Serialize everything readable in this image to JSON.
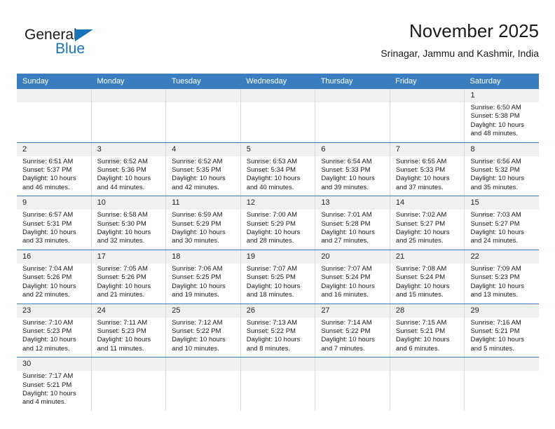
{
  "brand": {
    "name_part1": "General",
    "name_part2": "Blue",
    "triangle_color": "#1574bb"
  },
  "header": {
    "title": "November 2025",
    "subtitle": "Srinagar, Jammu and Kashmir, India"
  },
  "theme": {
    "header_blue": "#3a7ebf",
    "date_band_gray": "#f0f0f0",
    "grid_line": "#d9d9d9",
    "text": "#1a1a1a"
  },
  "weekdays": [
    "Sunday",
    "Monday",
    "Tuesday",
    "Wednesday",
    "Thursday",
    "Friday",
    "Saturday"
  ],
  "weeks": [
    [
      {
        "day": "",
        "lines": []
      },
      {
        "day": "",
        "lines": []
      },
      {
        "day": "",
        "lines": []
      },
      {
        "day": "",
        "lines": []
      },
      {
        "day": "",
        "lines": []
      },
      {
        "day": "",
        "lines": []
      },
      {
        "day": "1",
        "lines": [
          "Sunrise: 6:50 AM",
          "Sunset: 5:38 PM",
          "Daylight: 10 hours",
          "and 48 minutes."
        ]
      }
    ],
    [
      {
        "day": "2",
        "lines": [
          "Sunrise: 6:51 AM",
          "Sunset: 5:37 PM",
          "Daylight: 10 hours",
          "and 46 minutes."
        ]
      },
      {
        "day": "3",
        "lines": [
          "Sunrise: 6:52 AM",
          "Sunset: 5:36 PM",
          "Daylight: 10 hours",
          "and 44 minutes."
        ]
      },
      {
        "day": "4",
        "lines": [
          "Sunrise: 6:52 AM",
          "Sunset: 5:35 PM",
          "Daylight: 10 hours",
          "and 42 minutes."
        ]
      },
      {
        "day": "5",
        "lines": [
          "Sunrise: 6:53 AM",
          "Sunset: 5:34 PM",
          "Daylight: 10 hours",
          "and 40 minutes."
        ]
      },
      {
        "day": "6",
        "lines": [
          "Sunrise: 6:54 AM",
          "Sunset: 5:33 PM",
          "Daylight: 10 hours",
          "and 39 minutes."
        ]
      },
      {
        "day": "7",
        "lines": [
          "Sunrise: 6:55 AM",
          "Sunset: 5:33 PM",
          "Daylight: 10 hours",
          "and 37 minutes."
        ]
      },
      {
        "day": "8",
        "lines": [
          "Sunrise: 6:56 AM",
          "Sunset: 5:32 PM",
          "Daylight: 10 hours",
          "and 35 minutes."
        ]
      }
    ],
    [
      {
        "day": "9",
        "lines": [
          "Sunrise: 6:57 AM",
          "Sunset: 5:31 PM",
          "Daylight: 10 hours",
          "and 33 minutes."
        ]
      },
      {
        "day": "10",
        "lines": [
          "Sunrise: 6:58 AM",
          "Sunset: 5:30 PM",
          "Daylight: 10 hours",
          "and 32 minutes."
        ]
      },
      {
        "day": "11",
        "lines": [
          "Sunrise: 6:59 AM",
          "Sunset: 5:29 PM",
          "Daylight: 10 hours",
          "and 30 minutes."
        ]
      },
      {
        "day": "12",
        "lines": [
          "Sunrise: 7:00 AM",
          "Sunset: 5:29 PM",
          "Daylight: 10 hours",
          "and 28 minutes."
        ]
      },
      {
        "day": "13",
        "lines": [
          "Sunrise: 7:01 AM",
          "Sunset: 5:28 PM",
          "Daylight: 10 hours",
          "and 27 minutes."
        ]
      },
      {
        "day": "14",
        "lines": [
          "Sunrise: 7:02 AM",
          "Sunset: 5:27 PM",
          "Daylight: 10 hours",
          "and 25 minutes."
        ]
      },
      {
        "day": "15",
        "lines": [
          "Sunrise: 7:03 AM",
          "Sunset: 5:27 PM",
          "Daylight: 10 hours",
          "and 24 minutes."
        ]
      }
    ],
    [
      {
        "day": "16",
        "lines": [
          "Sunrise: 7:04 AM",
          "Sunset: 5:26 PM",
          "Daylight: 10 hours",
          "and 22 minutes."
        ]
      },
      {
        "day": "17",
        "lines": [
          "Sunrise: 7:05 AM",
          "Sunset: 5:26 PM",
          "Daylight: 10 hours",
          "and 21 minutes."
        ]
      },
      {
        "day": "18",
        "lines": [
          "Sunrise: 7:06 AM",
          "Sunset: 5:25 PM",
          "Daylight: 10 hours",
          "and 19 minutes."
        ]
      },
      {
        "day": "19",
        "lines": [
          "Sunrise: 7:07 AM",
          "Sunset: 5:25 PM",
          "Daylight: 10 hours",
          "and 18 minutes."
        ]
      },
      {
        "day": "20",
        "lines": [
          "Sunrise: 7:07 AM",
          "Sunset: 5:24 PM",
          "Daylight: 10 hours",
          "and 16 minutes."
        ]
      },
      {
        "day": "21",
        "lines": [
          "Sunrise: 7:08 AM",
          "Sunset: 5:24 PM",
          "Daylight: 10 hours",
          "and 15 minutes."
        ]
      },
      {
        "day": "22",
        "lines": [
          "Sunrise: 7:09 AM",
          "Sunset: 5:23 PM",
          "Daylight: 10 hours",
          "and 13 minutes."
        ]
      }
    ],
    [
      {
        "day": "23",
        "lines": [
          "Sunrise: 7:10 AM",
          "Sunset: 5:23 PM",
          "Daylight: 10 hours",
          "and 12 minutes."
        ]
      },
      {
        "day": "24",
        "lines": [
          "Sunrise: 7:11 AM",
          "Sunset: 5:23 PM",
          "Daylight: 10 hours",
          "and 11 minutes."
        ]
      },
      {
        "day": "25",
        "lines": [
          "Sunrise: 7:12 AM",
          "Sunset: 5:22 PM",
          "Daylight: 10 hours",
          "and 10 minutes."
        ]
      },
      {
        "day": "26",
        "lines": [
          "Sunrise: 7:13 AM",
          "Sunset: 5:22 PM",
          "Daylight: 10 hours",
          "and 8 minutes."
        ]
      },
      {
        "day": "27",
        "lines": [
          "Sunrise: 7:14 AM",
          "Sunset: 5:22 PM",
          "Daylight: 10 hours",
          "and 7 minutes."
        ]
      },
      {
        "day": "28",
        "lines": [
          "Sunrise: 7:15 AM",
          "Sunset: 5:21 PM",
          "Daylight: 10 hours",
          "and 6 minutes."
        ]
      },
      {
        "day": "29",
        "lines": [
          "Sunrise: 7:16 AM",
          "Sunset: 5:21 PM",
          "Daylight: 10 hours",
          "and 5 minutes."
        ]
      }
    ],
    [
      {
        "day": "30",
        "lines": [
          "Sunrise: 7:17 AM",
          "Sunset: 5:21 PM",
          "Daylight: 10 hours",
          "and 4 minutes."
        ]
      },
      {
        "day": "",
        "lines": []
      },
      {
        "day": "",
        "lines": []
      },
      {
        "day": "",
        "lines": []
      },
      {
        "day": "",
        "lines": []
      },
      {
        "day": "",
        "lines": []
      },
      {
        "day": "",
        "lines": []
      }
    ]
  ]
}
